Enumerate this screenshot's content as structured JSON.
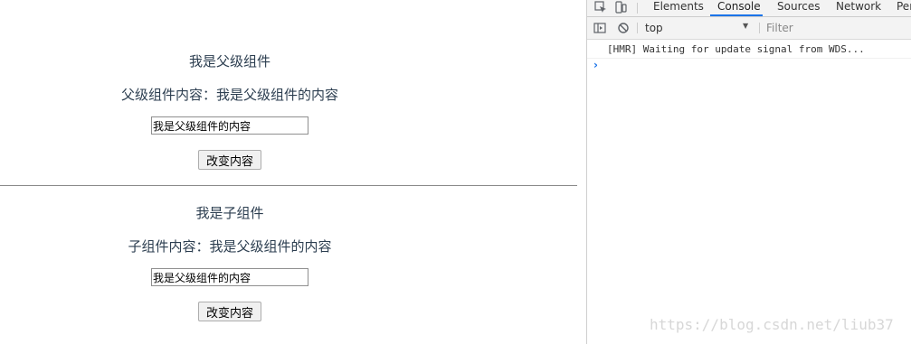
{
  "parent": {
    "title": "我是父级组件",
    "content_line": "父级组件内容：我是父级组件的内容",
    "input_value": "我是父级组件的内容",
    "button_label": "改变内容"
  },
  "child": {
    "title": "我是子组件",
    "content_line": "子组件内容：我是父级组件的内容",
    "input_value": "我是父级组件的内容",
    "button_label": "改变内容"
  },
  "devtools": {
    "tabs": [
      "Elements",
      "Console",
      "Sources",
      "Network",
      "Per"
    ],
    "active_tab": "Console",
    "context": "top",
    "filter_placeholder": "Filter",
    "messages": [
      "[HMR] Waiting for update signal from WDS..."
    ],
    "prompt_symbol": "›"
  },
  "watermark": "https://blog.csdn.net/liub37",
  "colors": {
    "text": "#2c3e50",
    "accent": "#1a73e8"
  }
}
